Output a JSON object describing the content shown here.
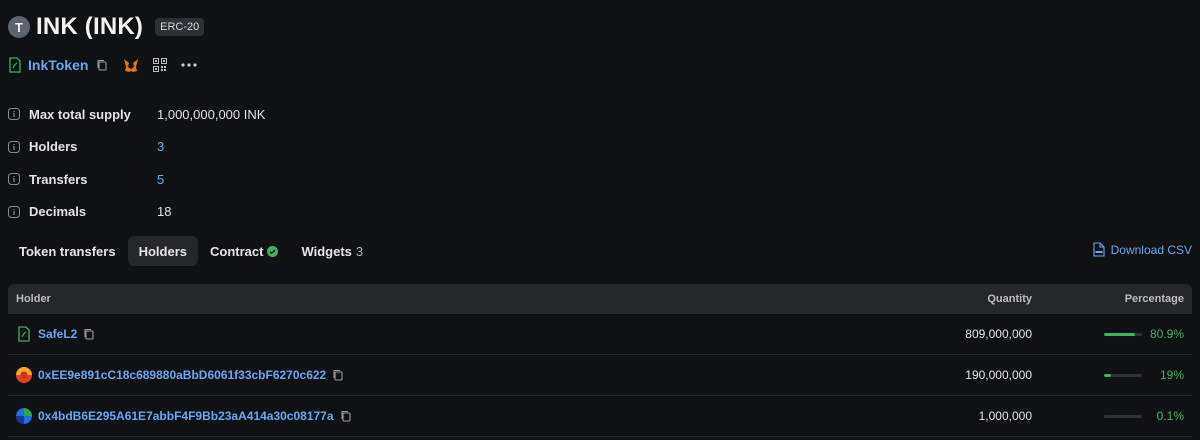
{
  "header": {
    "avatar_letter": "T",
    "title": "INK (INK)",
    "badge": "ERC-20"
  },
  "address": {
    "name": "InkToken"
  },
  "details": [
    {
      "label": "Max total supply",
      "value": "1,000,000,000 INK",
      "link": false
    },
    {
      "label": "Holders",
      "value": "3",
      "link": true
    },
    {
      "label": "Transfers",
      "value": "5",
      "link": true
    },
    {
      "label": "Decimals",
      "value": "18",
      "link": false
    }
  ],
  "tabs": [
    {
      "label": "Token transfers",
      "active": false
    },
    {
      "label": "Holders",
      "active": true
    },
    {
      "label": "Contract",
      "active": false,
      "verified": true
    },
    {
      "label": "Widgets",
      "active": false,
      "count": "3"
    }
  ],
  "download_label": "Download CSV",
  "table": {
    "headers": {
      "holder": "Holder",
      "quantity": "Quantity",
      "percentage": "Percentage"
    },
    "rows": [
      {
        "holder": "SafeL2",
        "icon": "contract-icon",
        "quantity": "809,000,000",
        "percentage": "80.9%",
        "fraction": 0.809
      },
      {
        "holder": "0xEE9e891cC18c689880aBbD6061f33cbF6270c622",
        "icon": "identicon-orange",
        "quantity": "190,000,000",
        "percentage": "19%",
        "fraction": 0.19
      },
      {
        "holder": "0x4bdB6E295A61E7abbF4F9Bb23aA414a30c08177a",
        "icon": "identicon-blue",
        "quantity": "1,000,000",
        "percentage": "0.1%",
        "fraction": 0.001
      }
    ]
  },
  "colors": {
    "link": "#6aa8f2",
    "accent_green": "#3bb463",
    "background": "#101112"
  }
}
